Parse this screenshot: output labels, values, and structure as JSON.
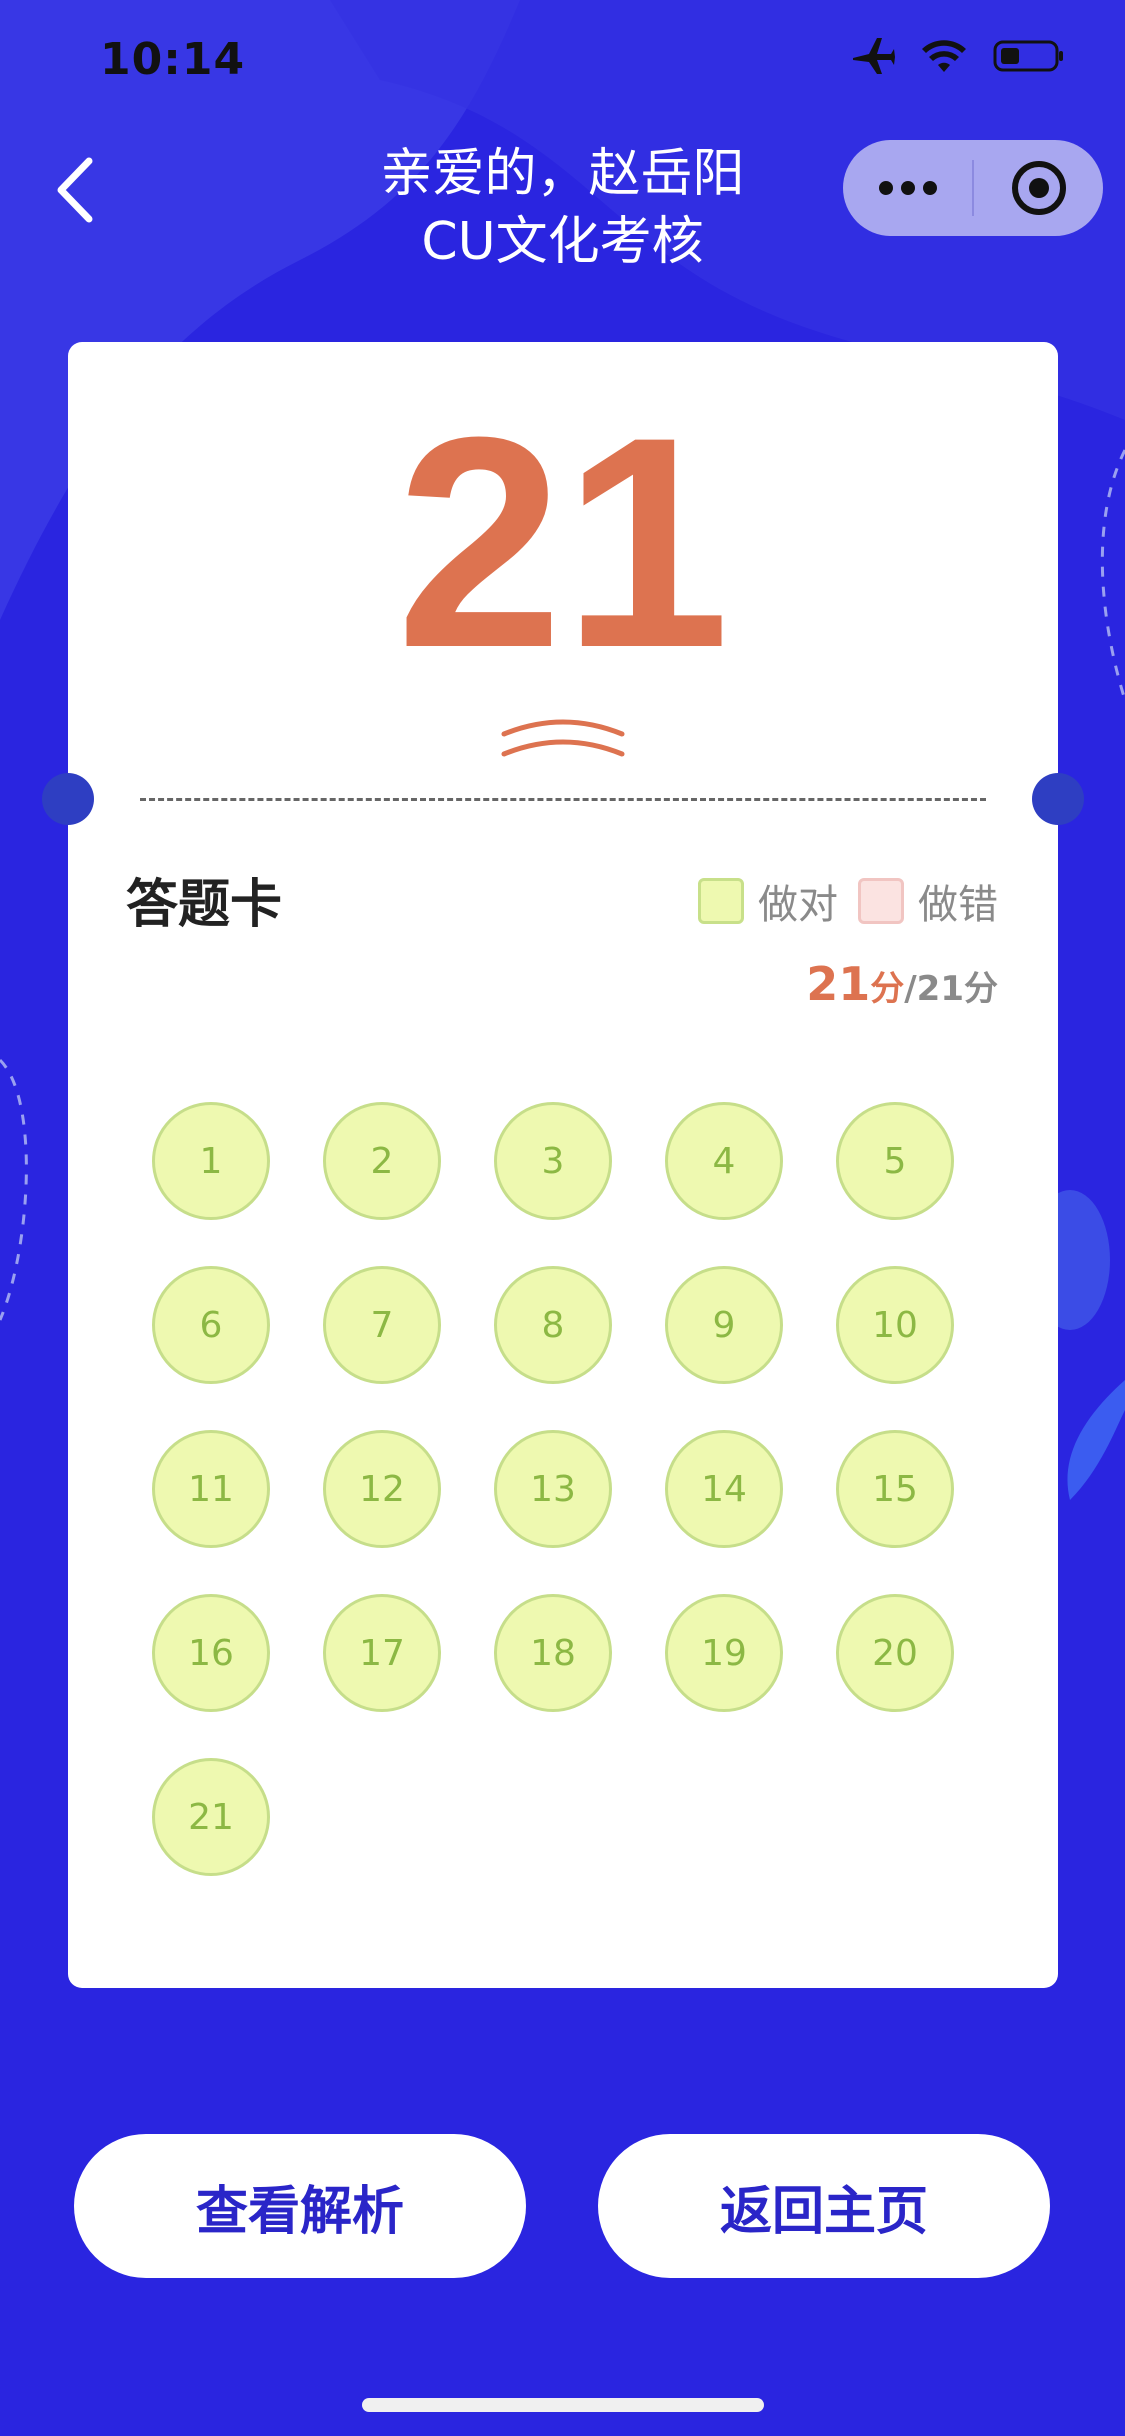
{
  "status_bar": {
    "time": "10:14"
  },
  "nav": {
    "title_line1": "亲爱的，赵岳阳",
    "title_line2": "CU文化考核"
  },
  "result": {
    "score": "21"
  },
  "answer_card": {
    "title": "答题卡",
    "legend": {
      "correct": "做对",
      "wrong": "做错"
    },
    "points_earned": "21",
    "points_unit": "分",
    "points_total": "/21分",
    "questions": [
      "1",
      "2",
      "3",
      "4",
      "5",
      "6",
      "7",
      "8",
      "9",
      "10",
      "11",
      "12",
      "13",
      "14",
      "15",
      "16",
      "17",
      "18",
      "19",
      "20",
      "21"
    ]
  },
  "actions": {
    "view_analysis": "查看解析",
    "back_home": "返回主页"
  },
  "colors": {
    "background": "#2a25e0",
    "score": "#dd7350",
    "correct_fill": "#eef9b0",
    "wrong_fill": "#fbe3e1",
    "button_text": "#2a25c8"
  }
}
